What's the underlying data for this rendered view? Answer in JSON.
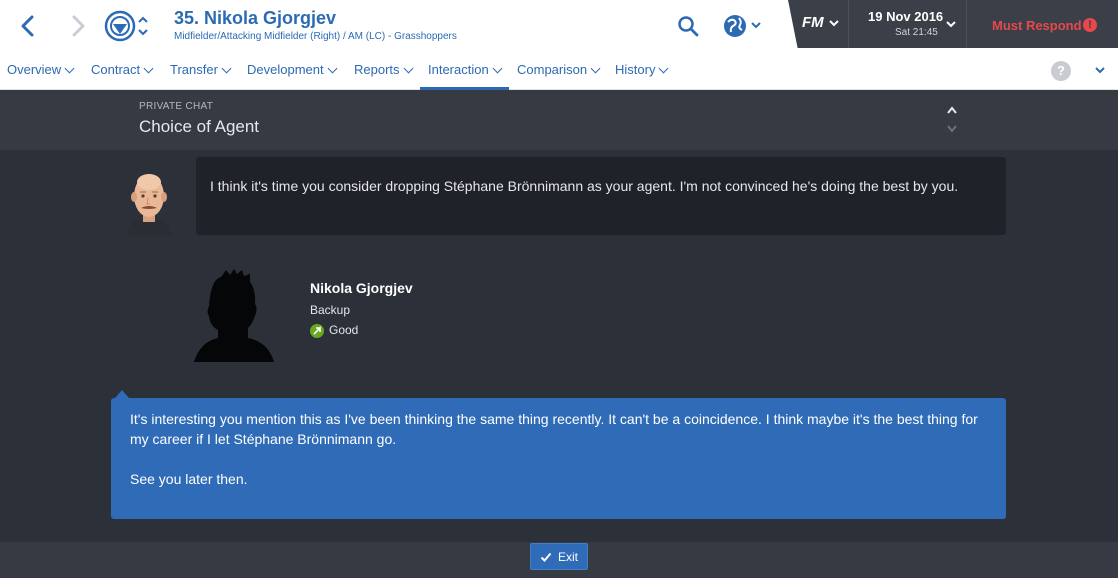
{
  "header": {
    "player_title": "35. Nikola Gjorgjev",
    "player_subtitle": "Midfielder/Attacking Midfielder (Right) / AM (LC) - Grasshoppers",
    "fm_logo": "FM",
    "date": "19 Nov 2016",
    "day_time": "Sat 21:45",
    "must_respond": "Must Respond",
    "must_respond_icon": "!",
    "accent_color": "#2c6ab3",
    "alert_color": "#e8484b"
  },
  "tabs": [
    {
      "label": "Overview"
    },
    {
      "label": "Contract"
    },
    {
      "label": "Transfer"
    },
    {
      "label": "Development"
    },
    {
      "label": "Reports"
    },
    {
      "label": "Interaction",
      "active": true
    },
    {
      "label": "Comparison"
    },
    {
      "label": "History"
    }
  ],
  "help_label": "?",
  "chat": {
    "kicker": "PRIVATE CHAT",
    "title": "Choice of Agent"
  },
  "manager_message": "I think it's time you consider dropping Stéphane Brönnimann as your agent. I'm not convinced he's doing the best by you.",
  "player_card": {
    "name": "Nikola Gjorgjev",
    "status": "Backup",
    "rating": "Good",
    "rating_color": "#6aa71f"
  },
  "player_reply": {
    "paragraph1": "It's interesting you mention this as I've been thinking the same thing recently. It can't be a coincidence. I think maybe it's the best thing for my career if I let Stéphane Brönnimann go.",
    "paragraph2": "See you later then."
  },
  "footer": {
    "exit_label": "Exit"
  }
}
